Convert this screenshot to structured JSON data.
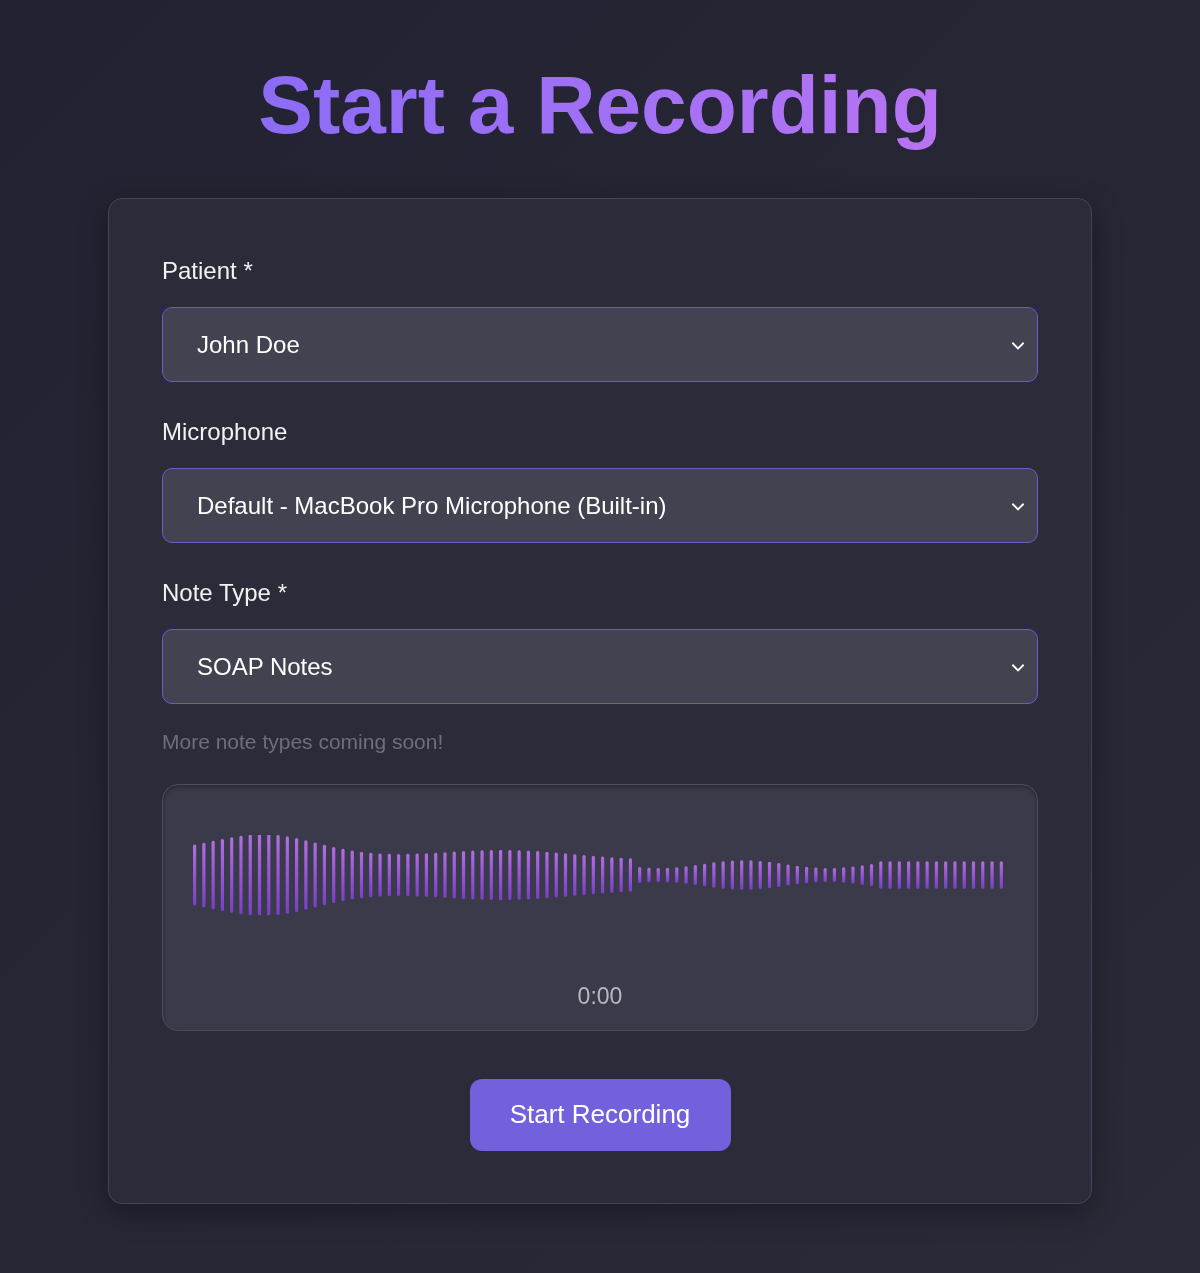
{
  "title": "Start a Recording",
  "fields": [
    {
      "label": "Patient *",
      "value": "John Doe"
    },
    {
      "label": "Microphone",
      "value": "Default - MacBook Pro Microphone (Built-in)"
    },
    {
      "label": "Note Type *",
      "value": "SOAP Notes",
      "hint": "More note types coming soon!"
    }
  ],
  "recorder": {
    "timer": "0:00"
  },
  "button": "Start Recording"
}
